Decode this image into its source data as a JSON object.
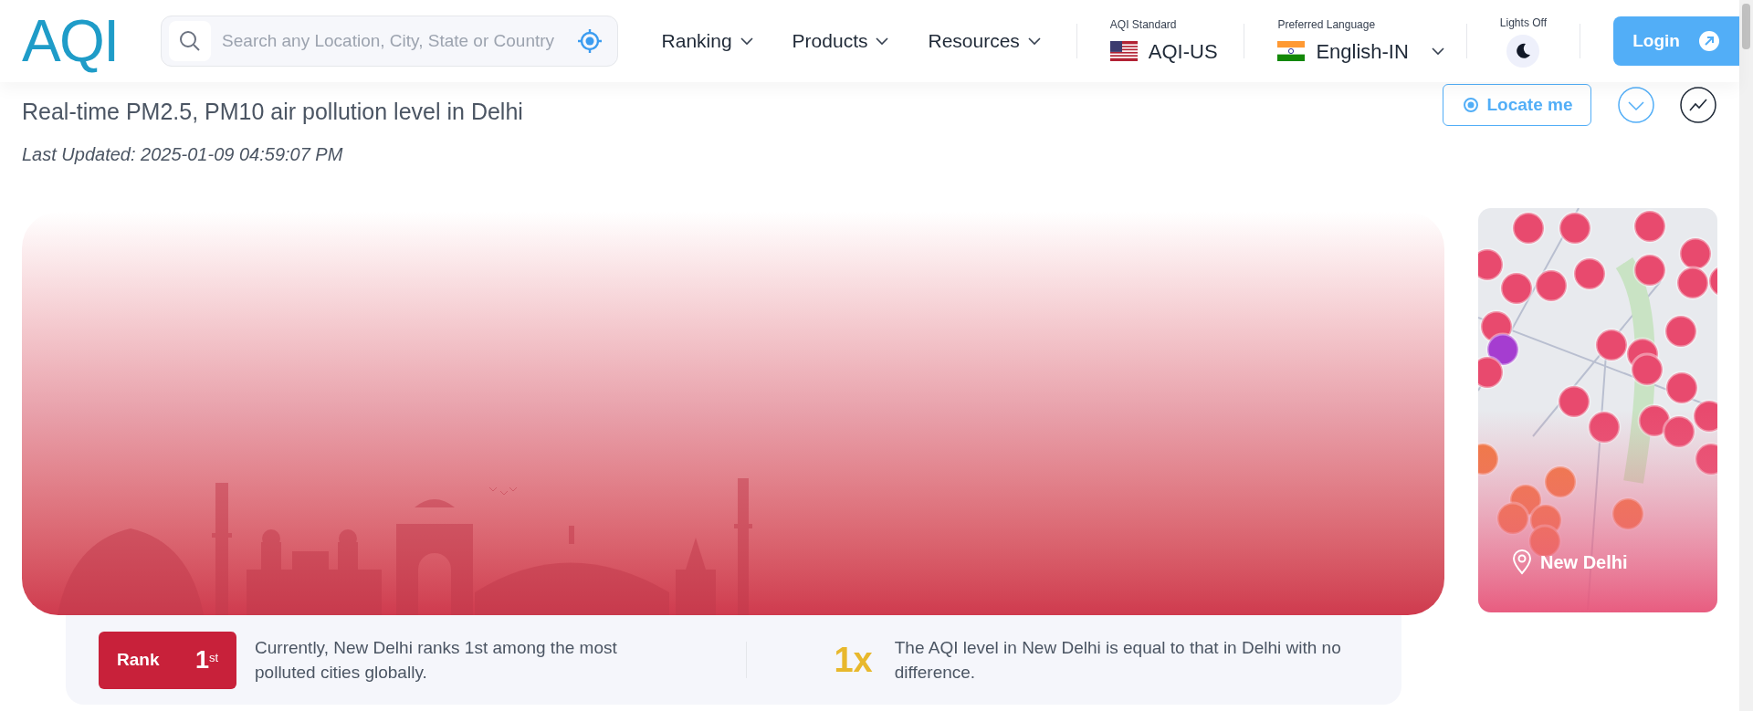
{
  "header": {
    "logo": "AQI",
    "search": {
      "placeholder": "Search any Location, City, State or Country"
    },
    "nav": [
      {
        "label": "Ranking"
      },
      {
        "label": "Products"
      },
      {
        "label": "Resources"
      }
    ],
    "aqi_standard": {
      "label": "AQI Standard",
      "value": "AQI-US"
    },
    "language": {
      "label": "Preferred Language",
      "value": "English-IN"
    },
    "lights": {
      "label": "Lights Off"
    },
    "login": "Login"
  },
  "page": {
    "title": "Real-time PM2.5, PM10 air pollution level in Delhi",
    "last_updated": "Last Updated: 2025-01-09 04:59:07 PM",
    "locate_button": "Locate me"
  },
  "map": {
    "kind": "picture",
    "location": "New Delhi"
  },
  "summary": {
    "rank_label": "Rank",
    "rank": "1$^{st}$",
    "rank_text": "Currently, New Delhi ranks 1st among the most polluted cities globally.",
    "ratio": "1x",
    "ratio_text": "The AQI level in New Delhi is equal to that in Delhi with no difference."
  }
}
